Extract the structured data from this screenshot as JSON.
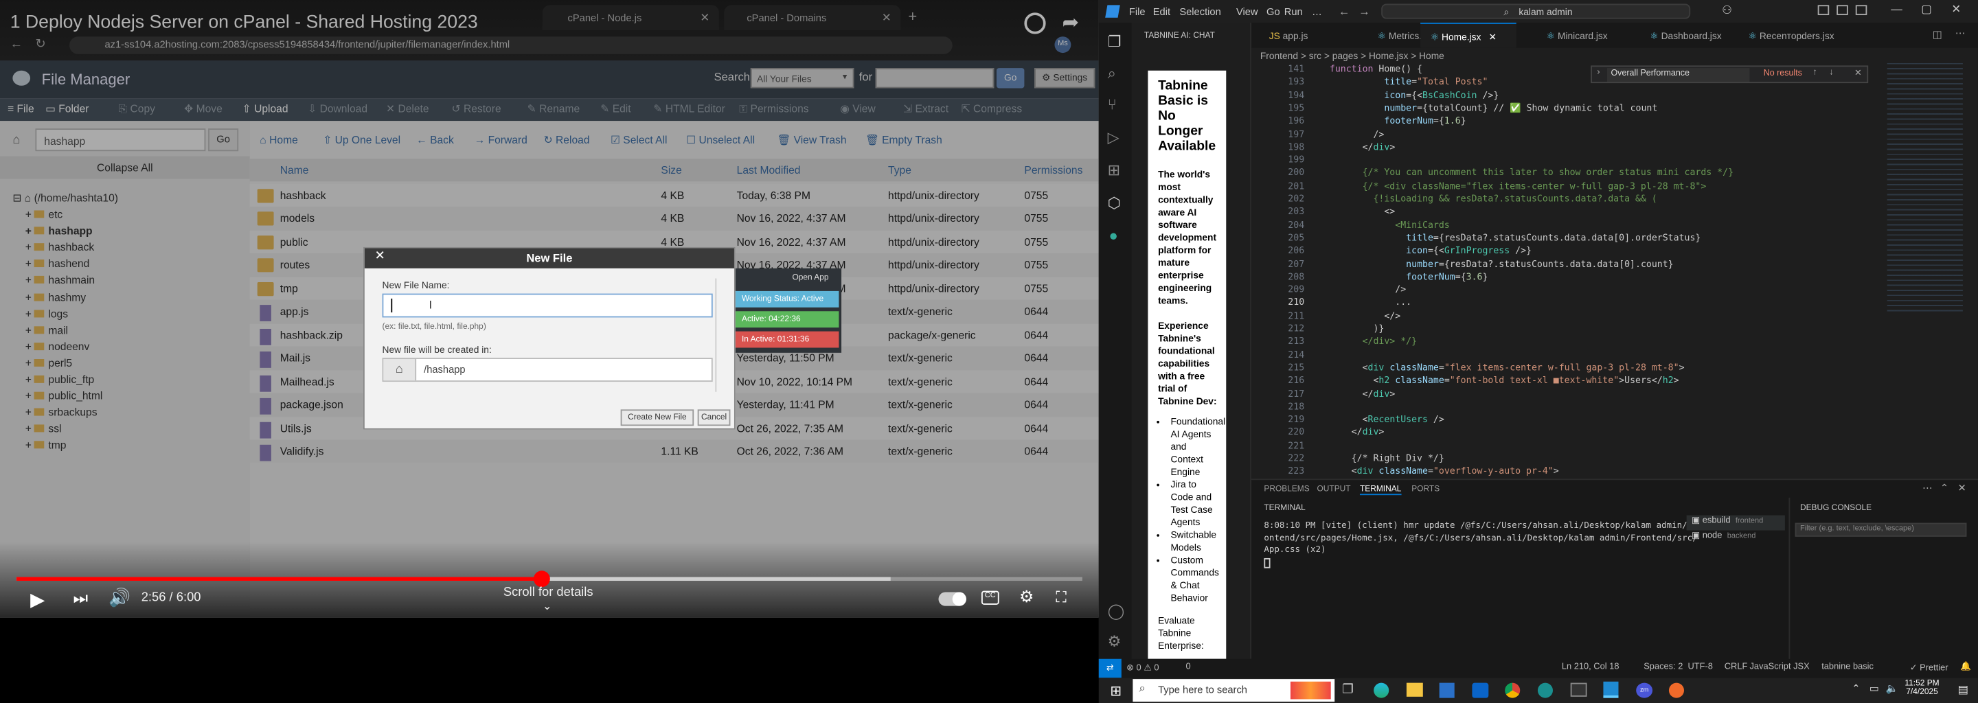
{
  "video": {
    "title": "1 Deploy Nodejs Server on cPanel - Shared Hosting 2023",
    "tabs": [
      "cPanel - Node.js",
      "cPanel - Domains"
    ],
    "url": "az1-ss104.a2hosting.com:2083/cpsess5194858434/frontend/jupiter/filemanager/index.html",
    "profile": "Ms",
    "time": "2:56 / 6:00",
    "scroll_hint": "Scroll for details",
    "progress": 0.493,
    "buffered": 0.82
  },
  "filemanager": {
    "title": "File Manager",
    "search_label": "Search",
    "search_scope": "All Your Files",
    "for_label": "for",
    "go": "Go",
    "settings": "Settings",
    "toolbar": [
      "File",
      "Folder",
      "Copy",
      "Move",
      "Upload",
      "Download",
      "Delete",
      "Restore",
      "Rename",
      "Edit",
      "HTML Editor",
      "Permissions",
      "View",
      "Extract",
      "Compress"
    ],
    "path_value": "hashapp",
    "collapse": "Collapse All",
    "actions": [
      "Home",
      "Up One Level",
      "Back",
      "Forward",
      "Reload",
      "Select All",
      "Unselect All",
      "View Trash",
      "Empty Trash"
    ],
    "columns": [
      "Name",
      "Size",
      "Last Modified",
      "Type",
      "Permissions"
    ],
    "tree_root": "(/home/hashta10)",
    "tree": [
      "etc",
      "hashapp",
      "hashback",
      "hashend",
      "hashmain",
      "hashmy",
      "logs",
      "mail",
      "nodeenv",
      "perl5",
      "public_ftp",
      "public_html",
      "srbackups",
      "ssl",
      "tmp"
    ],
    "files": [
      {
        "name": "hashback",
        "size": "4 KB",
        "modified": "Today, 6:38 PM",
        "type": "httpd/unix-directory",
        "perm": "0755",
        "kind": "folder"
      },
      {
        "name": "models",
        "size": "4 KB",
        "modified": "Nov 16, 2022, 4:37 AM",
        "type": "httpd/unix-directory",
        "perm": "0755",
        "kind": "folder"
      },
      {
        "name": "public",
        "size": "4 KB",
        "modified": "Nov 16, 2022, 4:37 AM",
        "type": "httpd/unix-directory",
        "perm": "0755",
        "kind": "folder"
      },
      {
        "name": "routes",
        "size": "4 KB",
        "modified": "Nov 16, 2022, 4:37 AM",
        "type": "httpd/unix-directory",
        "perm": "0755",
        "kind": "folder"
      },
      {
        "name": "tmp",
        "size": "4 KB",
        "modified": "Nov 16, 2022, 4:37 AM",
        "type": "httpd/unix-directory",
        "perm": "0755",
        "kind": "folder"
      },
      {
        "name": "app.js",
        "size": "",
        "modified": "",
        "type": "text/x-generic",
        "perm": "0644",
        "kind": "file"
      },
      {
        "name": "hashback.zip",
        "size": "",
        "modified": "",
        "type": "package/x-generic",
        "perm": "0644",
        "kind": "file"
      },
      {
        "name": "Mail.js",
        "size": "",
        "modified": "Yesterday, 11:50 PM",
        "type": "text/x-generic",
        "perm": "0644",
        "kind": "file"
      },
      {
        "name": "Mailhead.js",
        "size": "",
        "modified": "Nov 10, 2022, 10:14 PM",
        "type": "text/x-generic",
        "perm": "0644",
        "kind": "file"
      },
      {
        "name": "package.json",
        "size": "",
        "modified": "Yesterday, 11:41 PM",
        "type": "text/x-generic",
        "perm": "0644",
        "kind": "file"
      },
      {
        "name": "Utils.js",
        "size": "",
        "modified": "Oct 26, 2022, 7:35 AM",
        "type": "text/x-generic",
        "perm": "0644",
        "kind": "file"
      },
      {
        "name": "Validify.js",
        "size": "1.11 KB",
        "modified": "Oct 26, 2022, 7:36 AM",
        "type": "text/x-generic",
        "perm": "0644",
        "kind": "file"
      }
    ],
    "modal": {
      "title": "New File",
      "name_label": "New File Name:",
      "hint": "(ex: file.txt, file.html, file.php)",
      "created_label": "New file will be created in:",
      "dir_value": "/hashapp",
      "create": "Create New File",
      "cancel": "Cancel"
    },
    "status_widget": {
      "open": "Open App",
      "working": "Working Status: Active",
      "active": "Active: 04:22:36",
      "inactive": "In Active: 01:31:36"
    }
  },
  "vscode": {
    "menu": [
      "File",
      "Edit",
      "Selection",
      "View",
      "Go",
      "Run",
      "…"
    ],
    "search": "kalam admin",
    "chat_header": "TABNINE AI: CHAT",
    "chat": {
      "heading": "Tabnine Basic is No Longer Available",
      "p1": "The world's most contextually aware AI software development platform for mature enterprise engineering teams.",
      "p2": "Experience Tabnine's foundational capabilities with a free trial of Tabnine Dev:",
      "bullets": [
        "Foundational AI Agents and Context Engine",
        "Jira to Code and Test Case Agents",
        "Switchable Models",
        "Custom Commands & Chat Behavior"
      ],
      "p3": "Evaluate Tabnine Enterprise:"
    },
    "tabs": [
      "app.js",
      "Metrics.jsx",
      "Home.jsx",
      "Minicard.jsx",
      "Dashboard.jsx",
      "Recenторders.jsx"
    ],
    "breadcrumb": "Frontend > src > pages > Home.jsx > Home",
    "find": {
      "value": "Overall Performance",
      "result": "No results"
    },
    "lines": [
      {
        "n": "141",
        "t": "function Home() {"
      },
      {
        "n": "193",
        "t": "          title=\"Total Posts\""
      },
      {
        "n": "194",
        "t": "          icon={<BsCashCoin />}"
      },
      {
        "n": "195",
        "t": "          number={totalCount} // ✅ Show dynamic total count"
      },
      {
        "n": "196",
        "t": "          footerNum={1.6}"
      },
      {
        "n": "197",
        "t": "        />"
      },
      {
        "n": "198",
        "t": "      </div>"
      },
      {
        "n": "199",
        "t": ""
      },
      {
        "n": "200",
        "t": "      {/* You can uncomment this later to show order status mini cards */}"
      },
      {
        "n": "201",
        "t": "      {/* <div className=\"flex items-center w-full gap-3 pl-28 mt-8\">"
      },
      {
        "n": "202",
        "t": "        {!isLoading && resData?.statusCounts.data?.data && ("
      },
      {
        "n": "203",
        "t": "          <>"
      },
      {
        "n": "204",
        "t": "            <MiniCards"
      },
      {
        "n": "205",
        "t": "              title={resData?.statusCounts.data.data[0].orderStatus}"
      },
      {
        "n": "206",
        "t": "              icon={<GrInProgress />}"
      },
      {
        "n": "207",
        "t": "              number={resData?.statusCounts.data.data[0].count}"
      },
      {
        "n": "208",
        "t": "              footerNum={3.6}"
      },
      {
        "n": "209",
        "t": "            />"
      },
      {
        "n": "210",
        "t": "            ..."
      },
      {
        "n": "211",
        "t": "          </>"
      },
      {
        "n": "212",
        "t": "        )}"
      },
      {
        "n": "213",
        "t": "      </div> */}"
      },
      {
        "n": "214",
        "t": ""
      },
      {
        "n": "215",
        "t": "      <div className=\"flex items-center w-full gap-3 pl-28 mt-8\">"
      },
      {
        "n": "216",
        "t": "        <h2 className=\"font-bold text-xl ■text-white\">Users</h2>"
      },
      {
        "n": "217",
        "t": "      </div>"
      },
      {
        "n": "218",
        "t": ""
      },
      {
        "n": "219",
        "t": "      <RecentUsers />"
      },
      {
        "n": "220",
        "t": "    </div>"
      },
      {
        "n": "221",
        "t": ""
      },
      {
        "n": "222",
        "t": "    {/* Right Div */}"
      },
      {
        "n": "223",
        "t": "    <div className=\"overflow-y-auto pr-4\">"
      }
    ],
    "panel_tabs": [
      "PROBLEMS",
      "OUTPUT",
      "TERMINAL",
      "PORTS"
    ],
    "terminal_label": "TERMINAL",
    "terminal_lines": [
      "8:08:10 PM [vite] (client) hmr update /@fs/C:/Users/ahsan.ali/Desktop/kalam admin/Fr",
      "ontend/src/pages/Home.jsx, /@fs/C:/Users/ahsan.ali/Desktop/kalam admin/Frontend/src/",
      "App.css (x2)"
    ],
    "terminals": [
      {
        "name": "esbuild",
        "sub": "frontend"
      },
      {
        "name": "node",
        "sub": "backend"
      }
    ],
    "debug": {
      "title": "DEBUG CONSOLE",
      "placeholder": "Filter (e.g. text, !exclude, \\escape)"
    },
    "statusbar": {
      "errors": "⊗ 0 ⚠ 0",
      "left": "0",
      "pos": "Ln 210, Col 18",
      "spaces": "Spaces: 2",
      "enc": "UTF-8",
      "eol": "CRLF",
      "lang": "JavaScript JSX",
      "tabnine": "tabnine basic",
      "prettier": "✓ Prettier"
    }
  },
  "taskbar": {
    "search": "Type here to search",
    "time": "11:52 PM",
    "date": "7/4/2025"
  }
}
